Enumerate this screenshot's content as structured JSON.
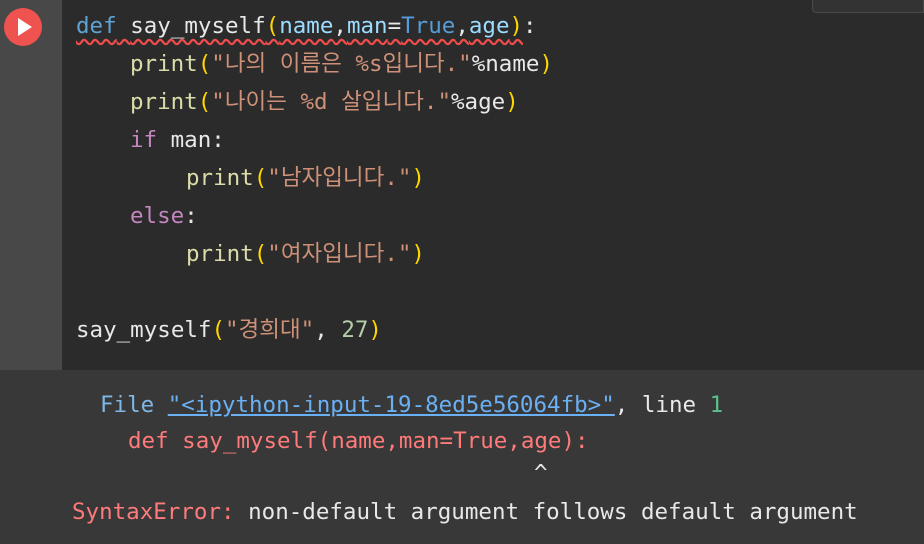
{
  "cell": {
    "run_button_label": "",
    "code_lines": [
      {
        "tokens": [
          "def",
          " ",
          "say_myself",
          "(",
          "name",
          ",",
          "man",
          "=",
          "True",
          ",",
          "age",
          ")",
          ":"
        ]
      },
      {
        "tokens": [
          "print",
          "(",
          "\"나의 이름은 %s입니다.\"",
          "%name",
          ")"
        ]
      },
      {
        "tokens": [
          "print",
          "(",
          "\"나이는 %d 살입니다.\"",
          "%age",
          ")"
        ]
      },
      {
        "tokens": [
          "if",
          " man:"
        ]
      },
      {
        "tokens": [
          "print",
          "(",
          "\"남자입니다.\"",
          ")"
        ]
      },
      {
        "tokens": [
          "else",
          ":"
        ]
      },
      {
        "tokens": [
          "print",
          "(",
          "\"여자입니다.\"",
          ")"
        ]
      },
      {
        "tokens": [
          "say_myself",
          "(",
          "\"경희대\"",
          ", ",
          "27",
          ")"
        ]
      }
    ]
  },
  "output": {
    "file_label": "File ",
    "file_link": "\"<ipython-input-19-8ed5e56064fb>\"",
    "line_label": ", line ",
    "line_number": "1",
    "error_code": "def say_myself(name,man=True,age):",
    "caret": "^",
    "error_type": "SyntaxError",
    "error_sep": ": ",
    "error_message": "non-default argument follows default argument"
  },
  "colors": {
    "run_button": "#ef5350",
    "keyword": "#5fa3d6",
    "string": "#ce9178",
    "paren": "#ffd700",
    "error": "#ff7a7a",
    "link": "#6ab0f3"
  }
}
